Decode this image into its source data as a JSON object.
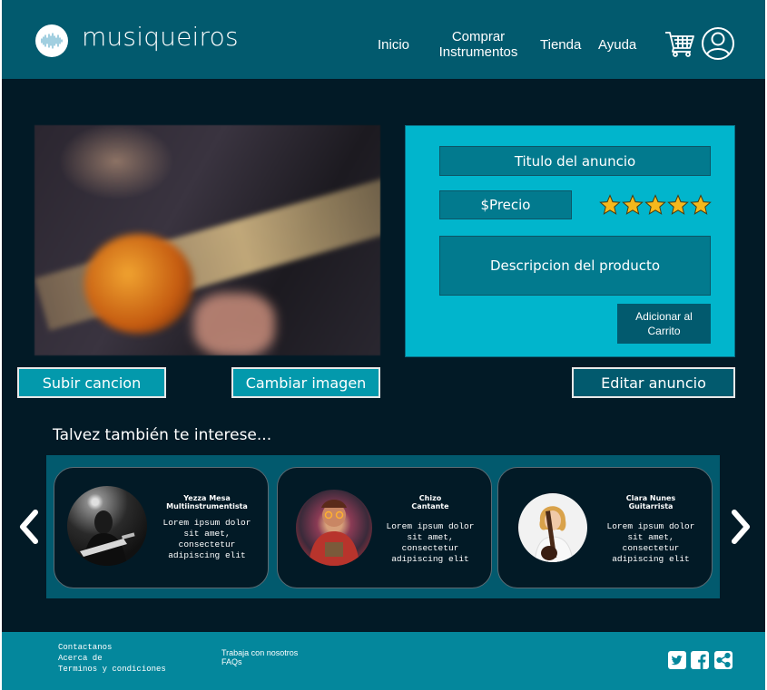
{
  "brand": {
    "name": "musiqueiros",
    "icon": "soundwave-icon"
  },
  "nav": {
    "inicio": "Inicio",
    "comprar_line1": "Comprar",
    "comprar_line2": "Instrumentos",
    "tienda": "Tienda",
    "ayuda": "Ayuda",
    "cart_icon": "cart-icon",
    "user_icon": "user-icon"
  },
  "product": {
    "title": "Titulo del anuncio",
    "price": "$Precio",
    "rating_stars": 5,
    "description": "Descripcion del producto",
    "add_to_cart_line1": "Adicionar al",
    "add_to_cart_line2": "Carrito"
  },
  "actions": {
    "upload_song": "Subir cancion",
    "change_image": "Cambiar imagen",
    "edit_ad": "Editar anuncio"
  },
  "recommendations": {
    "title": "Talvez también te interese...",
    "cards": [
      {
        "name_line1": "Yezza Mesa",
        "name_line2": "Multiinstrumentista",
        "text_lines": [
          "Lorem ipsum dolor",
          "sit amet,",
          "consectetur",
          "adipiscing elit"
        ]
      },
      {
        "name_line1": "Chizo",
        "name_line2": "Cantante",
        "text_lines": [
          "Lorem ipsum dolor",
          "sit amet,",
          "consectetur",
          "adipiscing elit"
        ]
      },
      {
        "name_line1": "Clara Nunes",
        "name_line2": "Guitarrista",
        "text_lines": [
          "Lorem ipsum dolor",
          "sit amet,",
          "consectetur",
          "adipiscing elit"
        ]
      }
    ]
  },
  "footer": {
    "contact": "Contactanos",
    "about": "Acerca de",
    "terms": "Terminos y condiciones",
    "jobs": "Trabaja con nosotros",
    "faqs": "FAQs",
    "social_icons": [
      "twitter-icon",
      "facebook-icon",
      "share-icon"
    ]
  },
  "colors": {
    "background": "#021a26",
    "header": "#025a6e",
    "panel": "#01b5cc",
    "field": "#027a8e",
    "footer": "#04879c",
    "star": "#f5b81c"
  }
}
